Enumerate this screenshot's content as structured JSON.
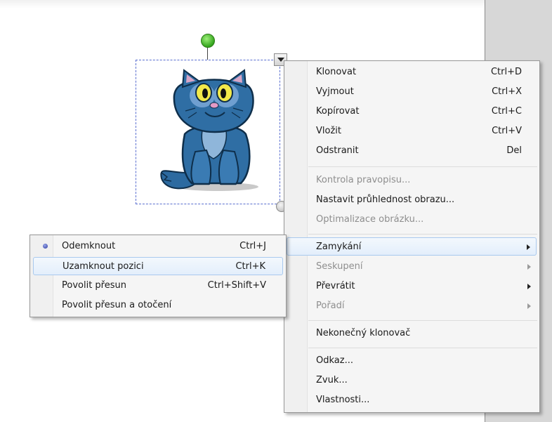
{
  "main_menu": {
    "items": [
      {
        "label": "Klonovat",
        "shortcut": "Ctrl+D"
      },
      {
        "label": "Vyjmout",
        "shortcut": "Ctrl+X"
      },
      {
        "label": "Kopírovat",
        "shortcut": "Ctrl+C"
      },
      {
        "label": "Vložit",
        "shortcut": "Ctrl+V"
      },
      {
        "label": "Odstranit",
        "shortcut": "Del"
      },
      {
        "label": "Kontrola pravopisu..."
      },
      {
        "label": "Nastavit průhlednost obrazu..."
      },
      {
        "label": "Optimalizace obrázku..."
      },
      {
        "label": "Zamykání"
      },
      {
        "label": "Seskupení"
      },
      {
        "label": "Převrátit"
      },
      {
        "label": "Pořadí"
      },
      {
        "label": "Nekonečný klonovač"
      },
      {
        "label": "Odkaz..."
      },
      {
        "label": "Zvuk..."
      },
      {
        "label": "Vlastnosti..."
      }
    ]
  },
  "lock_submenu": {
    "items": [
      {
        "label": "Odemknout",
        "shortcut": "Ctrl+J"
      },
      {
        "label": "Uzamknout pozici",
        "shortcut": "Ctrl+K"
      },
      {
        "label": "Povolit přesun",
        "shortcut": "Ctrl+Shift+V"
      },
      {
        "label": "Povolit přesun a otočení"
      }
    ]
  },
  "colors": {
    "highlight_border": "#a9c9ee",
    "selection_border": "#5a6fd0",
    "cat_blue": "#2f6ea4"
  }
}
